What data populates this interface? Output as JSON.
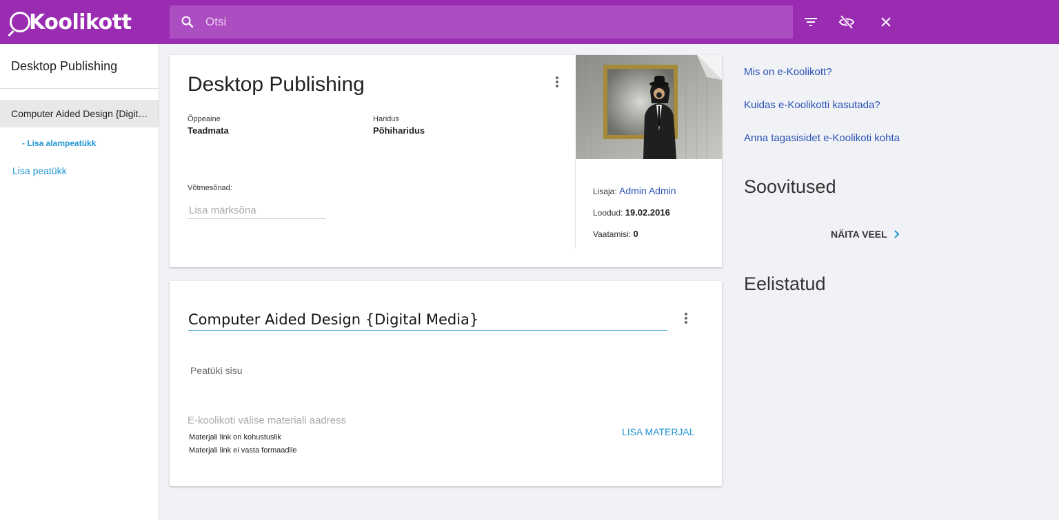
{
  "header": {
    "logo_text": "Koolikott",
    "search_placeholder": "Otsi",
    "icons": [
      "search-icon",
      "filter-icon",
      "eye-off-icon",
      "close-icon"
    ]
  },
  "sidebar": {
    "title": "Desktop Publishing",
    "items": [
      {
        "label": "Computer Aided Design {Digital Media}"
      }
    ],
    "add_subchapter": "- Lisa alampeatükk",
    "add_chapter": "Lisa peatükk"
  },
  "portfolio": {
    "title": "Desktop Publishing",
    "subject_label": "Õppeaine",
    "subject_value": "Teadmata",
    "education_label": "Haridus",
    "education_value": "Põhiharidus",
    "keywords_label": "Võtmesõnad:",
    "keywords_placeholder": "Lisa märksõna",
    "creator_label": "Lisaja:",
    "creator_value": "Admin Admin",
    "created_label": "Loodud:",
    "created_value": "19.02.2016",
    "views_label": "Vaatamisi:",
    "views_value": "0"
  },
  "chapter": {
    "title": "Computer Aided Design {Digital Media}",
    "content_placeholder": "Peatüki sisu",
    "material_placeholder": "E-koolikoti välise materiali aadress",
    "error_required": "Materjali link on kohustuslik",
    "error_format": "Materjali link ei vasta formaadile",
    "add_material": "LISA MATERJAL"
  },
  "right": {
    "links": [
      "Mis on e-Koolikott?",
      "Kuidas e-Koolikotti kasutada?",
      "Anna tagasisidet e-Koolikoti kohta"
    ],
    "recommendations_heading": "Soovitused",
    "show_more": "NÄITA VEEL",
    "favorites_heading": "Eelistatud"
  },
  "colors": {
    "header": "#9a2cb2",
    "search_bg": "#ac4dc2",
    "accent_link": "#2196d3",
    "text_link": "#2a4fb5"
  }
}
